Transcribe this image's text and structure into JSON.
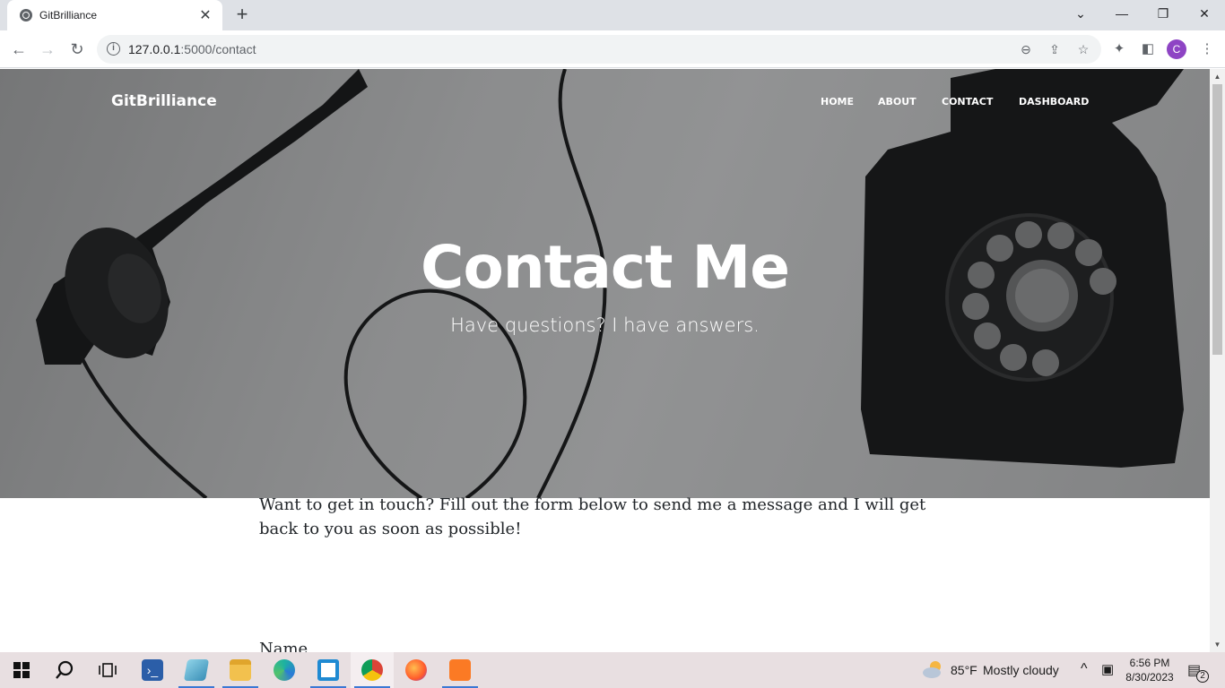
{
  "browser": {
    "tab_title": "GitBrilliance",
    "tab_close": "✕",
    "new_tab": "+",
    "url_host": "127.0.0.1",
    "url_rest": ":5000/contact",
    "profile_initial": "C",
    "window_controls": {
      "dropdown": "⌄",
      "minimize": "—",
      "restore": "❐",
      "close": "✕"
    }
  },
  "site": {
    "brand": "GitBrilliance",
    "nav": {
      "home": "HOME",
      "about": "ABOUT",
      "contact": "CONTACT",
      "dashboard": "DASHBOARD"
    },
    "hero": {
      "title": "Contact Me",
      "subtitle": "Have questions? I have answers."
    },
    "intro": "Want to get in touch? Fill out the form below to send me a message and I will get back to you as soon as possible!",
    "form": {
      "name_label": "Name"
    }
  },
  "taskbar": {
    "weather_temp": "85°F",
    "weather_desc": "Mostly cloudy",
    "time": "6:56 PM",
    "date": "8/30/2023",
    "notification_count": "2",
    "colors": {
      "background": "#e8dfe1",
      "accent": "#3b78d4"
    }
  }
}
